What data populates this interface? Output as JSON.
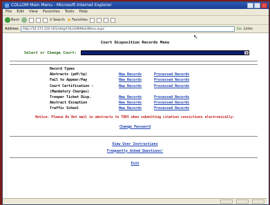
{
  "window": {
    "title": "COLLOM Main Menu - Microsoft Internet Explorer"
  },
  "menubar": {
    "items": [
      "File",
      "Edit",
      "View",
      "Favorites",
      "Tools",
      "Help"
    ]
  },
  "toolbar": {
    "back_label": "Back",
    "search_label": "Search",
    "favorites_label": "Favorites"
  },
  "address": {
    "label": "Address",
    "url": "http://10.171.120.101/ultig/COLLOM/MainMenu.aspx",
    "go_label": "Go",
    "links_label": "Links"
  },
  "page": {
    "title": "Court Disposition Records Menu",
    "court_label": "Select or Change Court:",
    "court_selected": "",
    "records_header": "Record Types",
    "records": [
      {
        "type": "Abstracts (pdf/tp)",
        "new": "New Records",
        "processed": "Processed Records"
      },
      {
        "type": "Fail to Appear/Pay",
        "new": "New Records",
        "processed": "Processed Records"
      },
      {
        "type": "Court Certification -",
        "new": "New Records",
        "processed": "Processed Records"
      },
      {
        "type": "(Mandatory Charges)",
        "new": "",
        "processed": ""
      },
      {
        "type": "Trooper Ticket Disp.",
        "new": "New Records",
        "processed": "Processed Records"
      },
      {
        "type": "Abstract Exception",
        "new": "New Records",
        "processed": "Processed Records"
      },
      {
        "type": "Traffic School",
        "new": "New Records",
        "processed": "Processed Records"
      }
    ],
    "notice": "Notice: Please Do Not mail in abstracts to TDDS when submitting citation convictions electronically.",
    "change_password": "Change Password",
    "view_instructions": "View User Instructions",
    "faq": "Frequently Asked Questions!",
    "exit": "Exit"
  },
  "colors": {
    "accent_link": "#1a3fb0",
    "notice_red": "#c31a1a",
    "label_green": "#2d6b1a",
    "select_fill": "#0e1f6e"
  }
}
